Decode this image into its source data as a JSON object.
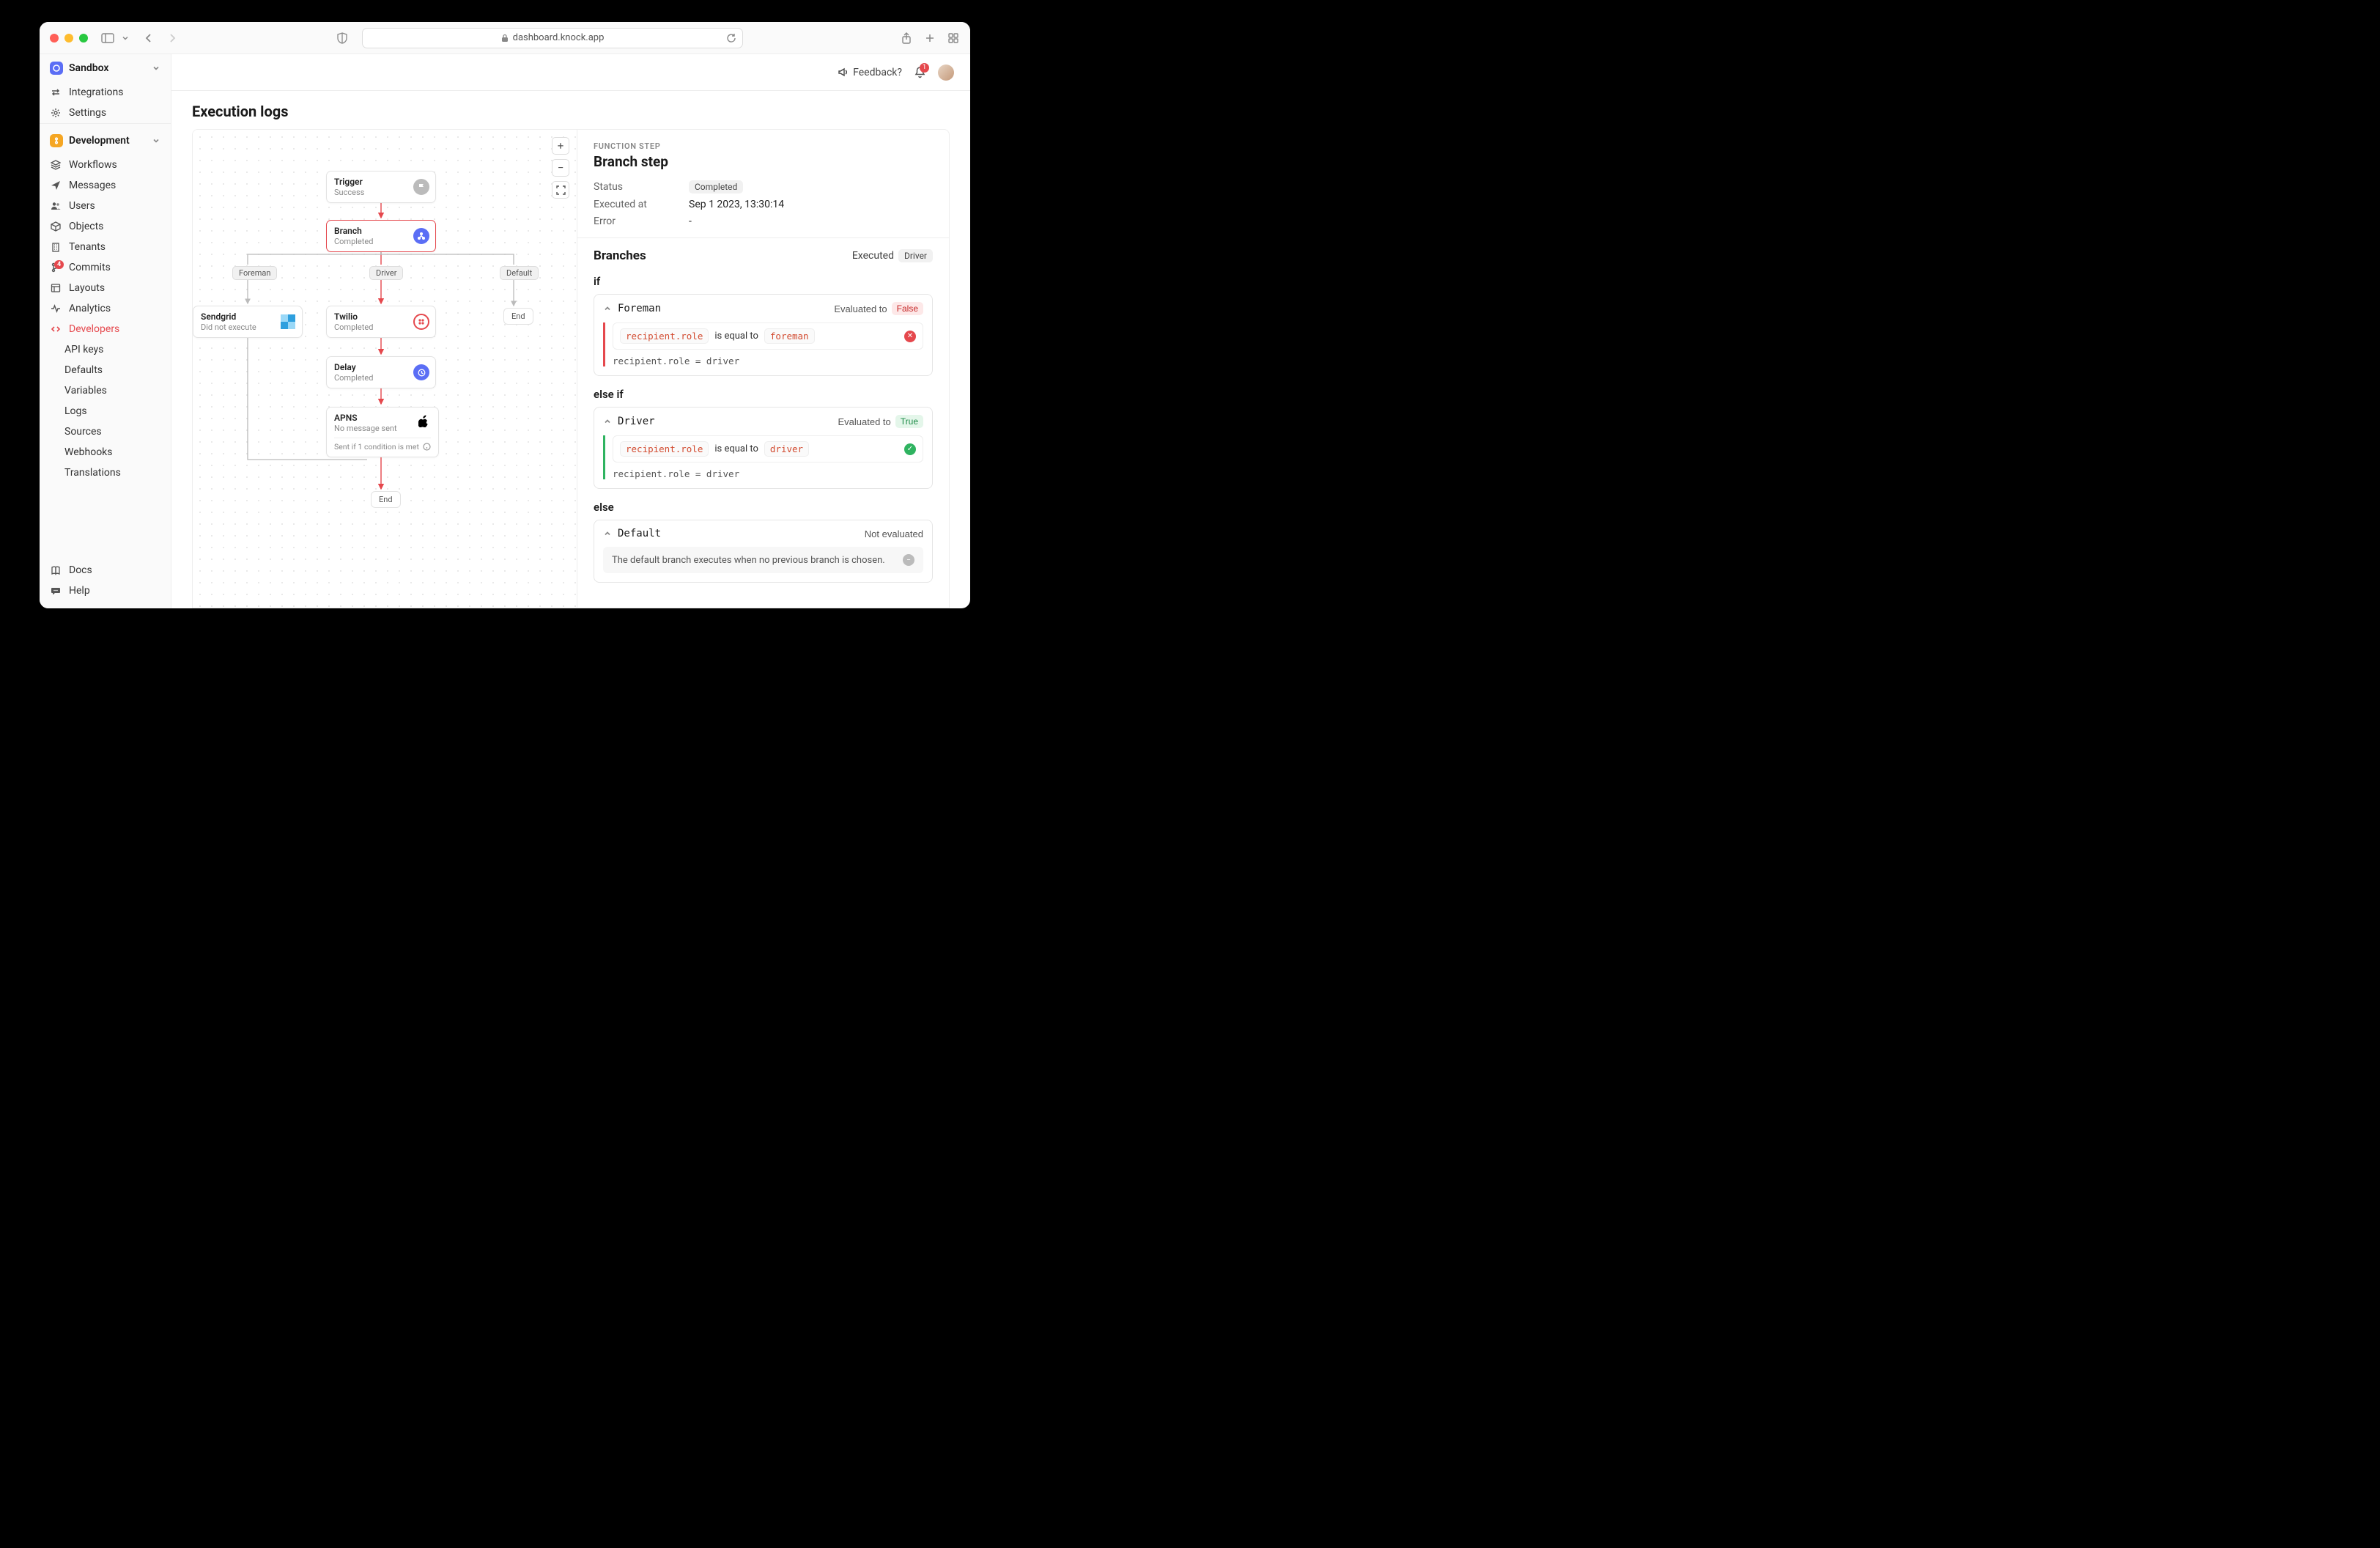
{
  "chrome": {
    "url": "dashboard.knock.app"
  },
  "sidebar": {
    "workspace": {
      "label": "Sandbox"
    },
    "top": [
      {
        "icon": "arrows",
        "label": "Integrations"
      },
      {
        "icon": "gear",
        "label": "Settings"
      }
    ],
    "env": {
      "label": "Development"
    },
    "nav": [
      {
        "icon": "stack",
        "label": "Workflows"
      },
      {
        "icon": "send",
        "label": "Messages"
      },
      {
        "icon": "users",
        "label": "Users"
      },
      {
        "icon": "cube",
        "label": "Objects"
      },
      {
        "icon": "building",
        "label": "Tenants"
      },
      {
        "icon": "branch",
        "label": "Commits",
        "badge": "4"
      },
      {
        "icon": "layout",
        "label": "Layouts"
      },
      {
        "icon": "pulse",
        "label": "Analytics"
      },
      {
        "icon": "code",
        "label": "Developers",
        "active": true
      }
    ],
    "sub": [
      {
        "label": "API keys"
      },
      {
        "label": "Defaults"
      },
      {
        "label": "Variables"
      },
      {
        "label": "Logs"
      },
      {
        "label": "Sources"
      },
      {
        "label": "Webhooks"
      },
      {
        "label": "Translations"
      }
    ],
    "bottom": [
      {
        "icon": "book",
        "label": "Docs"
      },
      {
        "icon": "chat",
        "label": "Help"
      }
    ]
  },
  "topbar": {
    "feedback": "Feedback?",
    "notifications": "1"
  },
  "page": {
    "title": "Execution logs"
  },
  "flow": {
    "trigger": {
      "title": "Trigger",
      "sub": "Success"
    },
    "branch": {
      "title": "Branch",
      "sub": "Completed"
    },
    "labels": {
      "foreman": "Foreman",
      "driver": "Driver",
      "default": "Default"
    },
    "sendgrid": {
      "title": "Sendgrid",
      "sub": "Did not execute"
    },
    "twilio": {
      "title": "Twilio",
      "sub": "Completed"
    },
    "delay": {
      "title": "Delay",
      "sub": "Completed"
    },
    "apns": {
      "title": "APNS",
      "sub": "No message sent",
      "foot": "Sent if 1 condition is met"
    },
    "end1": "End",
    "end2": "End"
  },
  "detail": {
    "kicker": "FUNCTION STEP",
    "title": "Branch step",
    "status_label": "Status",
    "status": "Completed",
    "executed_label": "Executed at",
    "executed": "Sep 1 2023, 13:30:14",
    "error_label": "Error",
    "error": "-",
    "branches_title": "Branches",
    "executed_word": "Executed",
    "executed_badge": "Driver",
    "if_label": "if",
    "elseif_label": "else if",
    "else_label": "else",
    "foreman": {
      "name": "Foreman",
      "eval_text": "Evaluated to",
      "eval_badge": "False",
      "var": "recipient.role",
      "op": "is equal to",
      "val": "foreman",
      "result": "recipient.role = driver"
    },
    "driver": {
      "name": "Driver",
      "eval_text": "Evaluated to",
      "eval_badge": "True",
      "var": "recipient.role",
      "op": "is equal to",
      "val": "driver",
      "result": "recipient.role = driver"
    },
    "default": {
      "name": "Default",
      "eval_text": "Not evaluated",
      "note": "The default branch executes when no previous branch is chosen."
    }
  }
}
